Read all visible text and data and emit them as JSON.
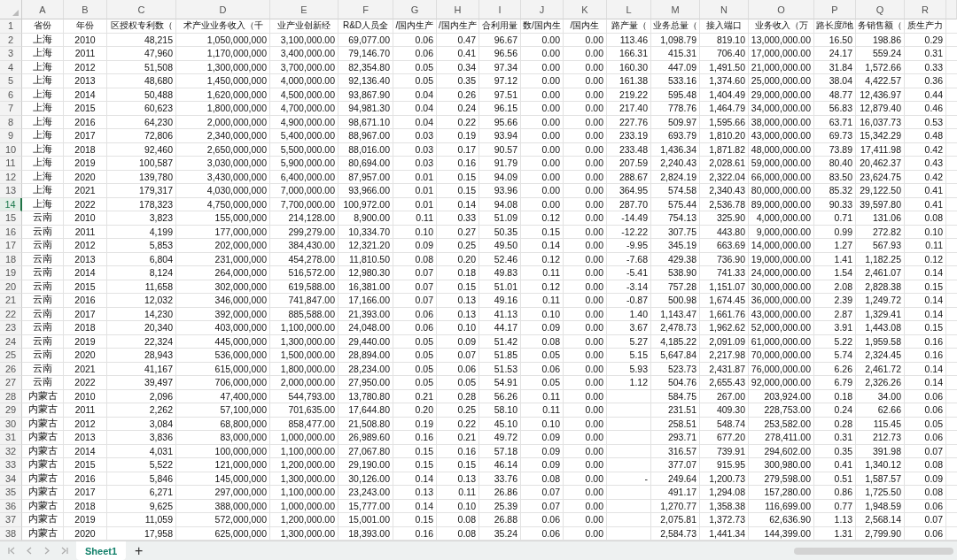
{
  "columns": [
    "A",
    "B",
    "C",
    "D",
    "E",
    "F",
    "G",
    "H",
    "I",
    "J",
    "K",
    "L",
    "M",
    "N",
    "O",
    "P",
    "Q",
    "R"
  ],
  "rows": [
    {
      "number": "1",
      "selected": false,
      "cells": [
        "省份",
        "年份",
        "区授权专利数（",
        "术产业业务收入（千",
        "业产业创新经",
        "R&D人员全",
        "/国内生产",
        "/国内生产",
        "合利用量",
        "数/国内生",
        "/国内生",
        "路产量（",
        "业务总量（",
        "接入端口",
        "业务收入（万",
        "路长度/地",
        "务销售额（",
        "质生产力"
      ]
    },
    {
      "number": "2",
      "selected": false,
      "cells": [
        "上海",
        "2010",
        "48,215",
        "1,050,000,000",
        "3,100,000.00",
        "69,077.00",
        "0.06",
        "0.47",
        "96.67",
        "0.00",
        "0.00",
        "113.46",
        "1,098.79",
        "819.10",
        "13,000,000.00",
        "16.50",
        "198.86",
        "0.29"
      ]
    },
    {
      "number": "3",
      "selected": false,
      "cells": [
        "上海",
        "2011",
        "47,960",
        "1,170,000,000",
        "3,400,000.00",
        "79,146.70",
        "0.06",
        "0.41",
        "96.56",
        "0.00",
        "0.00",
        "166.31",
        "415.31",
        "706.40",
        "17,000,000.00",
        "24.17",
        "559.24",
        "0.31"
      ]
    },
    {
      "number": "4",
      "selected": false,
      "cells": [
        "上海",
        "2012",
        "51,508",
        "1,300,000,000",
        "3,700,000.00",
        "82,354.80",
        "0.05",
        "0.34",
        "97.34",
        "0.00",
        "0.00",
        "160.30",
        "447.09",
        "1,491.50",
        "21,000,000.00",
        "31.84",
        "1,572.66",
        "0.33"
      ]
    },
    {
      "number": "5",
      "selected": false,
      "cells": [
        "上海",
        "2013",
        "48,680",
        "1,450,000,000",
        "4,000,000.00",
        "92,136.40",
        "0.05",
        "0.35",
        "97.12",
        "0.00",
        "0.00",
        "161.38",
        "533.16",
        "1,374.60",
        "25,000,000.00",
        "38.04",
        "4,422.57",
        "0.36"
      ]
    },
    {
      "number": "6",
      "selected": false,
      "cells": [
        "上海",
        "2014",
        "50,488",
        "1,620,000,000",
        "4,500,000.00",
        "93,867.90",
        "0.04",
        "0.26",
        "97.51",
        "0.00",
        "0.00",
        "219.22",
        "595.48",
        "1,404.49",
        "29,000,000.00",
        "48.77",
        "12,436.97",
        "0.44"
      ]
    },
    {
      "number": "7",
      "selected": false,
      "cells": [
        "上海",
        "2015",
        "60,623",
        "1,800,000,000",
        "4,700,000.00",
        "94,981.30",
        "0.04",
        "0.24",
        "96.15",
        "0.00",
        "0.00",
        "217.40",
        "778.76",
        "1,464.79",
        "34,000,000.00",
        "56.83",
        "12,879.40",
        "0.46"
      ]
    },
    {
      "number": "8",
      "selected": false,
      "cells": [
        "上海",
        "2016",
        "64,230",
        "2,000,000,000",
        "4,900,000.00",
        "98,671.10",
        "0.04",
        "0.22",
        "95.66",
        "0.00",
        "0.00",
        "227.76",
        "509.97",
        "1,595.66",
        "38,000,000.00",
        "63.71",
        "16,037.73",
        "0.53"
      ]
    },
    {
      "number": "9",
      "selected": false,
      "cells": [
        "上海",
        "2017",
        "72,806",
        "2,340,000,000",
        "5,400,000.00",
        "88,967.00",
        "0.03",
        "0.19",
        "93.94",
        "0.00",
        "0.00",
        "233.19",
        "693.79",
        "1,810.20",
        "43,000,000.00",
        "69.73",
        "15,342.29",
        "0.48"
      ]
    },
    {
      "number": "10",
      "selected": false,
      "cells": [
        "上海",
        "2018",
        "92,460",
        "2,650,000,000",
        "5,500,000.00",
        "88,016.00",
        "0.03",
        "0.17",
        "90.57",
        "0.00",
        "0.00",
        "233.48",
        "1,436.34",
        "1,871.82",
        "48,000,000.00",
        "73.89",
        "17,411.98",
        "0.42"
      ]
    },
    {
      "number": "11",
      "selected": false,
      "cells": [
        "上海",
        "2019",
        "100,587",
        "3,030,000,000",
        "5,900,000.00",
        "80,694.00",
        "0.03",
        "0.16",
        "91.79",
        "0.00",
        "0.00",
        "207.59",
        "2,240.43",
        "2,028.61",
        "59,000,000.00",
        "80.40",
        "20,462.37",
        "0.43"
      ]
    },
    {
      "number": "12",
      "selected": false,
      "cells": [
        "上海",
        "2020",
        "139,780",
        "3,430,000,000",
        "6,400,000.00",
        "87,957.00",
        "0.01",
        "0.15",
        "94.09",
        "0.00",
        "0.00",
        "288.67",
        "2,824.19",
        "2,322.04",
        "66,000,000.00",
        "83.50",
        "23,624.75",
        "0.42"
      ]
    },
    {
      "number": "13",
      "selected": false,
      "cells": [
        "上海",
        "2021",
        "179,317",
        "4,030,000,000",
        "7,000,000.00",
        "93,966.00",
        "0.01",
        "0.15",
        "93.96",
        "0.00",
        "0.00",
        "364.95",
        "574.58",
        "2,340.43",
        "80,000,000.00",
        "85.32",
        "29,122.50",
        "0.41"
      ]
    },
    {
      "number": "14",
      "selected": true,
      "cells": [
        "上海",
        "2022",
        "178,323",
        "4,750,000,000",
        "7,700,000.00",
        "100,972.00",
        "0.01",
        "0.14",
        "94.08",
        "0.00",
        "0.00",
        "287.70",
        "575.44",
        "2,536.78",
        "89,000,000.00",
        "90.33",
        "39,597.80",
        "0.41"
      ]
    },
    {
      "number": "15",
      "selected": false,
      "cells": [
        "云南",
        "2010",
        "3,823",
        "155,000,000",
        "214,128.00",
        "8,900.00",
        "0.11",
        "0.33",
        "51.09",
        "0.12",
        "0.00",
        "-14.49",
        "754.13",
        "325.90",
        "4,000,000.00",
        "0.71",
        "131.06",
        "0.08"
      ]
    },
    {
      "number": "16",
      "selected": false,
      "cells": [
        "云南",
        "2011",
        "4,199",
        "177,000,000",
        "299,279.00",
        "10,334.70",
        "0.10",
        "0.27",
        "50.35",
        "0.15",
        "0.00",
        "-12.22",
        "307.75",
        "443.80",
        "9,000,000.00",
        "0.99",
        "272.82",
        "0.10"
      ]
    },
    {
      "number": "17",
      "selected": false,
      "cells": [
        "云南",
        "2012",
        "5,853",
        "202,000,000",
        "384,430.00",
        "12,321.20",
        "0.09",
        "0.25",
        "49.50",
        "0.14",
        "0.00",
        "-9.95",
        "345.19",
        "663.69",
        "14,000,000.00",
        "1.27",
        "567.93",
        "0.11"
      ]
    },
    {
      "number": "18",
      "selected": false,
      "cells": [
        "云南",
        "2013",
        "6,804",
        "231,000,000",
        "454,278.00",
        "11,810.50",
        "0.08",
        "0.20",
        "52.46",
        "0.12",
        "0.00",
        "-7.68",
        "429.38",
        "736.90",
        "19,000,000.00",
        "1.41",
        "1,182.25",
        "0.12"
      ]
    },
    {
      "number": "19",
      "selected": false,
      "cells": [
        "云南",
        "2014",
        "8,124",
        "264,000,000",
        "516,572.00",
        "12,980.30",
        "0.07",
        "0.18",
        "49.83",
        "0.11",
        "0.00",
        "-5.41",
        "538.90",
        "741.33",
        "24,000,000.00",
        "1.54",
        "2,461.07",
        "0.14"
      ]
    },
    {
      "number": "20",
      "selected": false,
      "cells": [
        "云南",
        "2015",
        "11,658",
        "302,000,000",
        "619,588.00",
        "16,381.00",
        "0.07",
        "0.15",
        "51.01",
        "0.12",
        "0.00",
        "-3.14",
        "757.28",
        "1,151.07",
        "30,000,000.00",
        "2.08",
        "2,828.38",
        "0.15"
      ]
    },
    {
      "number": "21",
      "selected": false,
      "cells": [
        "云南",
        "2016",
        "12,032",
        "346,000,000",
        "741,847.00",
        "17,166.00",
        "0.07",
        "0.13",
        "49.16",
        "0.11",
        "0.00",
        "-0.87",
        "500.98",
        "1,674.45",
        "36,000,000.00",
        "2.39",
        "1,249.72",
        "0.14"
      ]
    },
    {
      "number": "22",
      "selected": false,
      "cells": [
        "云南",
        "2017",
        "14,230",
        "392,000,000",
        "885,588.00",
        "21,393.00",
        "0.06",
        "0.13",
        "41.13",
        "0.10",
        "0.00",
        "1.40",
        "1,143.47",
        "1,661.76",
        "43,000,000.00",
        "2.87",
        "1,329.41",
        "0.14"
      ]
    },
    {
      "number": "23",
      "selected": false,
      "cells": [
        "云南",
        "2018",
        "20,340",
        "403,000,000",
        "1,100,000.00",
        "24,048.00",
        "0.06",
        "0.10",
        "44.17",
        "0.09",
        "0.00",
        "3.67",
        "2,478.73",
        "1,962.62",
        "52,000,000.00",
        "3.91",
        "1,443.08",
        "0.15"
      ]
    },
    {
      "number": "24",
      "selected": false,
      "cells": [
        "云南",
        "2019",
        "22,324",
        "445,000,000",
        "1,300,000.00",
        "29,440.00",
        "0.05",
        "0.09",
        "51.42",
        "0.08",
        "0.00",
        "5.27",
        "4,185.22",
        "2,091.09",
        "61,000,000.00",
        "5.22",
        "1,959.58",
        "0.16"
      ]
    },
    {
      "number": "25",
      "selected": false,
      "cells": [
        "云南",
        "2020",
        "28,943",
        "536,000,000",
        "1,500,000.00",
        "28,894.00",
        "0.05",
        "0.07",
        "51.85",
        "0.05",
        "0.00",
        "5.15",
        "5,647.84",
        "2,217.98",
        "70,000,000.00",
        "5.74",
        "2,324.45",
        "0.16"
      ]
    },
    {
      "number": "26",
      "selected": false,
      "cells": [
        "云南",
        "2021",
        "41,167",
        "615,000,000",
        "1,800,000.00",
        "28,234.00",
        "0.05",
        "0.06",
        "51.53",
        "0.06",
        "0.00",
        "5.93",
        "523.73",
        "2,431.87",
        "76,000,000.00",
        "6.26",
        "2,461.72",
        "0.14"
      ]
    },
    {
      "number": "27",
      "selected": false,
      "cells": [
        "云南",
        "2022",
        "39,497",
        "706,000,000",
        "2,000,000.00",
        "27,950.00",
        "0.05",
        "0.05",
        "54.91",
        "0.05",
        "0.00",
        "1.12",
        "504.76",
        "2,655.43",
        "92,000,000.00",
        "6.79",
        "2,326.26",
        "0.14"
      ]
    },
    {
      "number": "28",
      "selected": false,
      "cells": [
        "内蒙古",
        "2010",
        "2,096",
        "47,400,000",
        "544,793.00",
        "13,780.80",
        "0.21",
        "0.28",
        "56.26",
        "0.11",
        "0.00",
        "",
        "584.75",
        "267.00",
        "203,924.00",
        "0.18",
        "34.00",
        "0.06"
      ]
    },
    {
      "number": "29",
      "selected": false,
      "cells": [
        "内蒙古",
        "2011",
        "2,262",
        "57,100,000",
        "701,635.00",
        "17,644.80",
        "0.20",
        "0.25",
        "58.10",
        "0.11",
        "0.00",
        "",
        "231.51",
        "409.30",
        "228,753.00",
        "0.24",
        "62.66",
        "0.06"
      ]
    },
    {
      "number": "30",
      "selected": false,
      "cells": [
        "内蒙古",
        "2012",
        "3,084",
        "68,800,000",
        "858,477.00",
        "21,508.80",
        "0.19",
        "0.22",
        "45.10",
        "0.10",
        "0.00",
        "",
        "258.51",
        "548.74",
        "253,582.00",
        "0.28",
        "115.45",
        "0.05"
      ]
    },
    {
      "number": "31",
      "selected": false,
      "cells": [
        "内蒙古",
        "2013",
        "3,836",
        "83,000,000",
        "1,000,000.00",
        "26,989.60",
        "0.16",
        "0.21",
        "49.72",
        "0.09",
        "0.00",
        "",
        "293.71",
        "677.20",
        "278,411.00",
        "0.31",
        "212.73",
        "0.06"
      ]
    },
    {
      "number": "32",
      "selected": false,
      "cells": [
        "内蒙古",
        "2014",
        "4,031",
        "100,000,000",
        "1,100,000.00",
        "27,067.80",
        "0.15",
        "0.16",
        "57.18",
        "0.09",
        "0.00",
        "",
        "316.57",
        "739.91",
        "294,602.00",
        "0.35",
        "391.98",
        "0.07"
      ]
    },
    {
      "number": "33",
      "selected": false,
      "cells": [
        "内蒙古",
        "2015",
        "5,522",
        "121,000,000",
        "1,200,000.00",
        "29,190.00",
        "0.15",
        "0.15",
        "46.14",
        "0.09",
        "0.00",
        "",
        "377.07",
        "915.95",
        "300,980.00",
        "0.41",
        "1,340.12",
        "0.08"
      ]
    },
    {
      "number": "34",
      "selected": false,
      "cells": [
        "内蒙古",
        "2016",
        "5,846",
        "145,000,000",
        "1,300,000.00",
        "30,126.00",
        "0.14",
        "0.13",
        "33.76",
        "0.08",
        "0.00",
        "-",
        "249.64",
        "1,200.73",
        "279,598.00",
        "0.51",
        "1,587.57",
        "0.09"
      ]
    },
    {
      "number": "35",
      "selected": false,
      "cells": [
        "内蒙古",
        "2017",
        "6,271",
        "297,000,000",
        "1,100,000.00",
        "23,243.00",
        "0.13",
        "0.11",
        "26.86",
        "0.07",
        "0.00",
        "",
        "491.17",
        "1,294.08",
        "157,280.00",
        "0.86",
        "1,725.50",
        "0.08"
      ]
    },
    {
      "number": "36",
      "selected": false,
      "cells": [
        "内蒙古",
        "2018",
        "9,625",
        "388,000,000",
        "1,000,000.00",
        "15,777.00",
        "0.14",
        "0.10",
        "25.39",
        "0.07",
        "0.00",
        "",
        "1,270.77",
        "1,358.38",
        "116,699.00",
        "0.77",
        "1,948.59",
        "0.06"
      ]
    },
    {
      "number": "37",
      "selected": false,
      "cells": [
        "内蒙古",
        "2019",
        "11,059",
        "572,000,000",
        "1,200,000.00",
        "15,001.00",
        "0.15",
        "0.08",
        "26.88",
        "0.06",
        "0.00",
        "",
        "2,075.81",
        "1,372.73",
        "62,636.90",
        "1.13",
        "2,568.14",
        "0.07"
      ]
    },
    {
      "number": "38",
      "selected": false,
      "cells": [
        "内蒙古",
        "2020",
        "17,958",
        "625,000,000",
        "1,300,000.00",
        "18,393.00",
        "0.16",
        "0.08",
        "35.24",
        "0.06",
        "0.00",
        "",
        "2,584.73",
        "1,441.34",
        "144,399.00",
        "1.31",
        "2,799.90",
        "0.06"
      ]
    }
  ],
  "sheet_tabs": [
    {
      "label": "Sheet1",
      "selected": true
    }
  ],
  "add_sheet": "+"
}
